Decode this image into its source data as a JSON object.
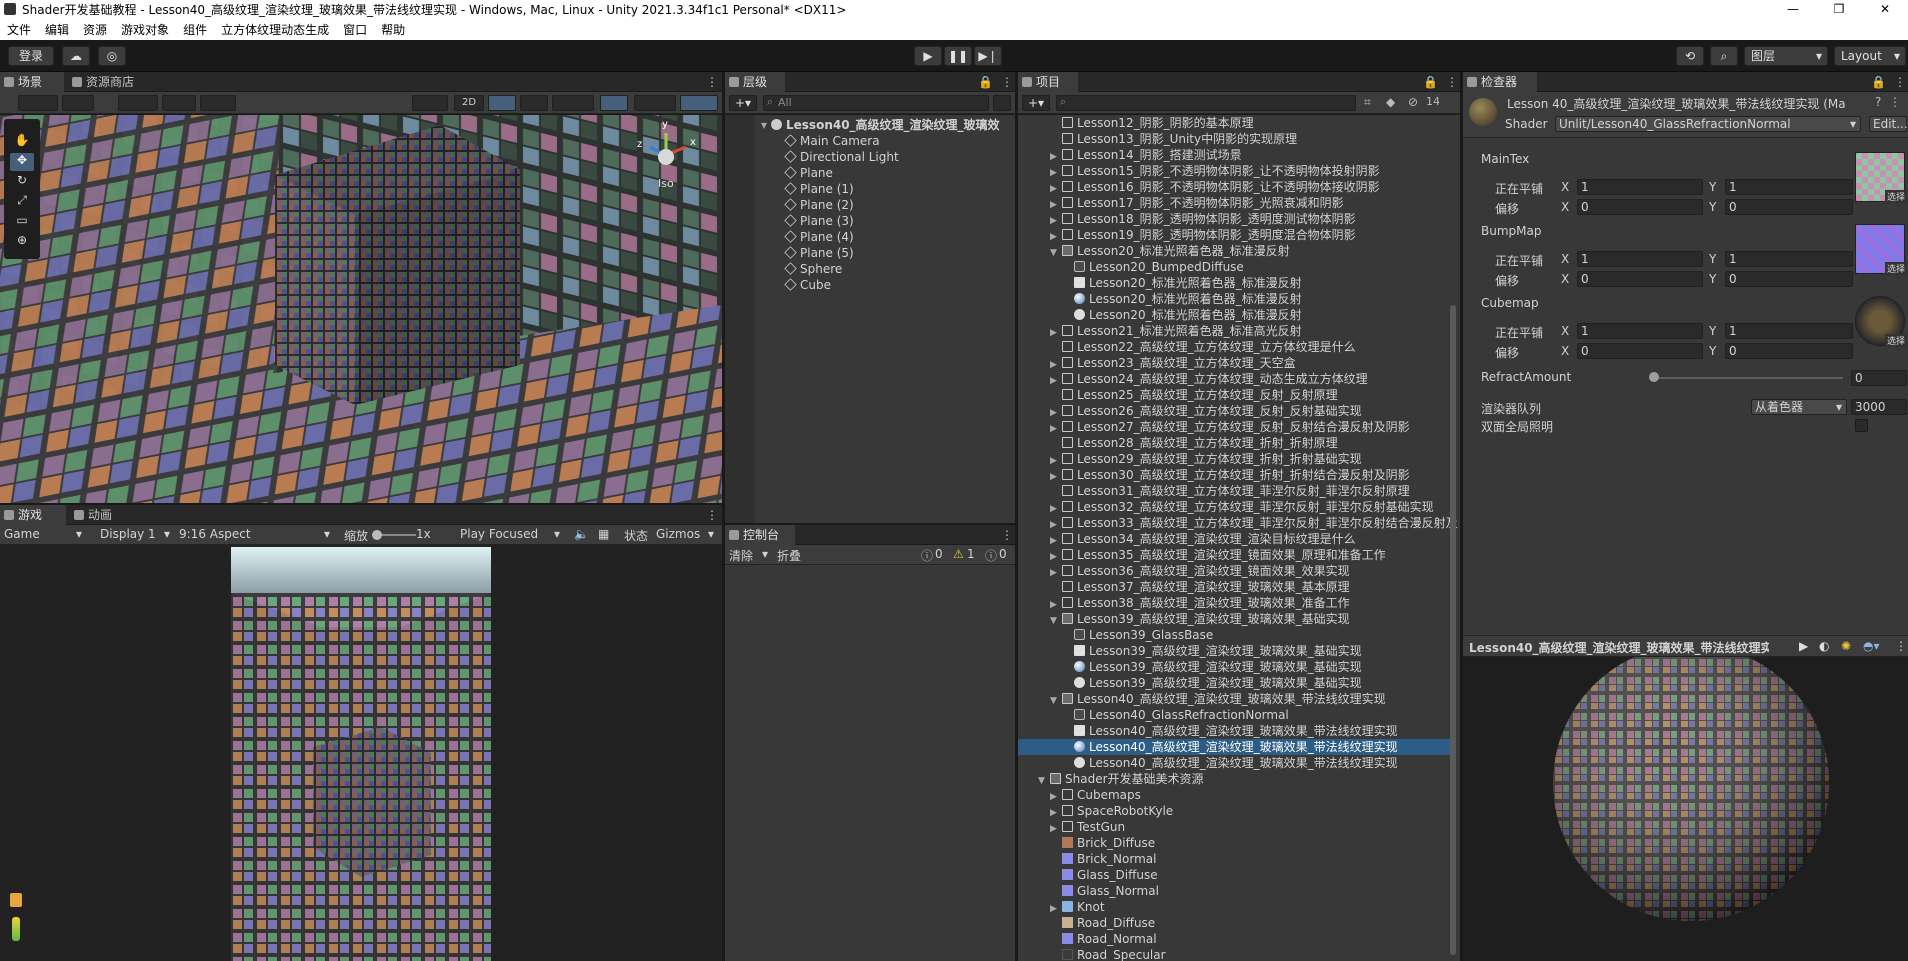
{
  "window": {
    "title": "Shader开发基础教程 - Lesson40_高级纹理_渲染纹理_玻璃效果_带法线纹理实现 - Windows, Mac, Linux - Unity 2021.3.34f1c1 Personal* <DX11>",
    "minimize": "—",
    "maximize": "❐",
    "close": "✕"
  },
  "menu": [
    "文件",
    "编辑",
    "资源",
    "游戏对象",
    "组件",
    "立方体纹理动态生成",
    "窗口",
    "帮助"
  ],
  "toolbar": {
    "login": "登录",
    "layers": "图层",
    "layout": "Layout"
  },
  "scene": {
    "tab_scene": "场景",
    "tab_store": "资源商店",
    "mode_2d": "2D",
    "gizmo_iso": "Iso",
    "gizmo_y": "y",
    "gizmo_z": "z",
    "gizmo_x": "x"
  },
  "game": {
    "tab_game": "游戏",
    "tab_anim": "动画",
    "display_mode": "Game",
    "display": "Display 1",
    "aspect": "9:16 Aspect",
    "scale_label": "缩放",
    "scale_value": "1x",
    "play_focused": "Play Focused",
    "stats": "状态",
    "gizmos": "Gizmos"
  },
  "hierarchy": {
    "tab": "层级",
    "search_placeholder": "All",
    "root": "Lesson40_高级纹理_渲染纹理_玻璃效",
    "items": [
      "Main Camera",
      "Directional Light",
      "Plane",
      "Plane (1)",
      "Plane (2)",
      "Plane (3)",
      "Plane (4)",
      "Plane (5)",
      "Sphere",
      "Cube"
    ]
  },
  "console": {
    "tab": "控制台",
    "clear": "清除",
    "collapse": "折叠",
    "count_info": "0",
    "count_warn": "1",
    "count_error": "0"
  },
  "project": {
    "tab": "项目",
    "hidden_count": "14",
    "rows": [
      {
        "text": "Lesson12_阴影_阴影的基本原理",
        "indent": 2,
        "icon": "folder",
        "arrow": "none"
      },
      {
        "text": "Lesson13_阴影_Unity中阴影的实现原理",
        "indent": 2,
        "icon": "folder",
        "arrow": "none"
      },
      {
        "text": "Lesson14_阴影_搭建测试场景",
        "indent": 2,
        "icon": "folder",
        "arrow": "closed"
      },
      {
        "text": "Lesson15_阴影_不透明物体阴影_让不透明物体投射阴影",
        "indent": 2,
        "icon": "folder",
        "arrow": "closed"
      },
      {
        "text": "Lesson16_阴影_不透明物体阴影_让不透明物体接收阴影",
        "indent": 2,
        "icon": "folder",
        "arrow": "closed"
      },
      {
        "text": "Lesson17_阴影_不透明物体阴影_光照衰减和阴影",
        "indent": 2,
        "icon": "folder",
        "arrow": "closed"
      },
      {
        "text": "Lesson18_阴影_透明物体阴影_透明度测试物体阴影",
        "indent": 2,
        "icon": "folder",
        "arrow": "closed"
      },
      {
        "text": "Lesson19_阴影_透明物体阴影_透明度混合物体阴影",
        "indent": 2,
        "icon": "folder",
        "arrow": "closed"
      },
      {
        "text": "Lesson20_标准光照着色器_标准漫反射",
        "indent": 2,
        "icon": "folder-open",
        "arrow": "open"
      },
      {
        "text": "Lesson20_BumpedDiffuse",
        "indent": 3,
        "icon": "shader",
        "arrow": "none"
      },
      {
        "text": "Lesson20_标准光照着色器_标准漫反射",
        "indent": 3,
        "icon": "script",
        "arrow": "none"
      },
      {
        "text": "Lesson20_标准光照着色器_标准漫反射",
        "indent": 3,
        "icon": "material",
        "arrow": "none"
      },
      {
        "text": "Lesson20_标准光照着色器_标准漫反射",
        "indent": 3,
        "icon": "unity",
        "arrow": "none"
      },
      {
        "text": "Lesson21_标准光照着色器_标准高光反射",
        "indent": 2,
        "icon": "folder",
        "arrow": "closed"
      },
      {
        "text": "Lesson22_高级纹理_立方体纹理_立方体纹理是什么",
        "indent": 2,
        "icon": "folder",
        "arrow": "none"
      },
      {
        "text": "Lesson23_高级纹理_立方体纹理_天空盒",
        "indent": 2,
        "icon": "folder",
        "arrow": "closed"
      },
      {
        "text": "Lesson24_高级纹理_立方体纹理_动态生成立方体纹理",
        "indent": 2,
        "icon": "folder",
        "arrow": "closed"
      },
      {
        "text": "Lesson25_高级纹理_立方体纹理_反射_反射原理",
        "indent": 2,
        "icon": "folder",
        "arrow": "none"
      },
      {
        "text": "Lesson26_高级纹理_立方体纹理_反射_反射基础实现",
        "indent": 2,
        "icon": "folder",
        "arrow": "closed"
      },
      {
        "text": "Lesson27_高级纹理_立方体纹理_反射_反射结合漫反射及阴影",
        "indent": 2,
        "icon": "folder",
        "arrow": "closed"
      },
      {
        "text": "Lesson28_高级纹理_立方体纹理_折射_折射原理",
        "indent": 2,
        "icon": "folder",
        "arrow": "none"
      },
      {
        "text": "Lesson29_高级纹理_立方体纹理_折射_折射基础实现",
        "indent": 2,
        "icon": "folder",
        "arrow": "closed"
      },
      {
        "text": "Lesson30_高级纹理_立方体纹理_折射_折射结合漫反射及阴影",
        "indent": 2,
        "icon": "folder",
        "arrow": "closed"
      },
      {
        "text": "Lesson31_高级纹理_立方体纹理_菲涅尔反射_菲涅尔反射原理",
        "indent": 2,
        "icon": "folder",
        "arrow": "none"
      },
      {
        "text": "Lesson32_高级纹理_立方体纹理_菲涅尔反射_菲涅尔反射基础实现",
        "indent": 2,
        "icon": "folder",
        "arrow": "closed"
      },
      {
        "text": "Lesson33_高级纹理_立方体纹理_菲涅尔反射_菲涅尔反射结合漫反射及",
        "indent": 2,
        "icon": "folder",
        "arrow": "closed"
      },
      {
        "text": "Lesson34_高级纹理_渲染纹理_渲染目标纹理是什么",
        "indent": 2,
        "icon": "folder",
        "arrow": "closed"
      },
      {
        "text": "Lesson35_高级纹理_渲染纹理_镜面效果_原理和准备工作",
        "indent": 2,
        "icon": "folder",
        "arrow": "closed"
      },
      {
        "text": "Lesson36_高级纹理_渲染纹理_镜面效果_效果实现",
        "indent": 2,
        "icon": "folder",
        "arrow": "closed"
      },
      {
        "text": "Lesson37_高级纹理_渲染纹理_玻璃效果_基本原理",
        "indent": 2,
        "icon": "folder",
        "arrow": "none"
      },
      {
        "text": "Lesson38_高级纹理_渲染纹理_玻璃效果_准备工作",
        "indent": 2,
        "icon": "folder",
        "arrow": "closed"
      },
      {
        "text": "Lesson39_高级纹理_渲染纹理_玻璃效果_基础实现",
        "indent": 2,
        "icon": "folder-open",
        "arrow": "open"
      },
      {
        "text": "Lesson39_GlassBase",
        "indent": 3,
        "icon": "shader",
        "arrow": "none"
      },
      {
        "text": "Lesson39_高级纹理_渲染纹理_玻璃效果_基础实现",
        "indent": 3,
        "icon": "script",
        "arrow": "none"
      },
      {
        "text": "Lesson39_高级纹理_渲染纹理_玻璃效果_基础实现",
        "indent": 3,
        "icon": "material",
        "arrow": "none"
      },
      {
        "text": "Lesson39_高级纹理_渲染纹理_玻璃效果_基础实现",
        "indent": 3,
        "icon": "unity",
        "arrow": "none"
      },
      {
        "text": "Lesson40_高级纹理_渲染纹理_玻璃效果_带法线纹理实现",
        "indent": 2,
        "icon": "folder-open",
        "arrow": "open"
      },
      {
        "text": "Lesson40_GlassRefractionNormal",
        "indent": 3,
        "icon": "shader",
        "arrow": "none"
      },
      {
        "text": "Lesson40_高级纹理_渲染纹理_玻璃效果_带法线纹理实现",
        "indent": 3,
        "icon": "script",
        "arrow": "none"
      },
      {
        "text": "Lesson40_高级纹理_渲染纹理_玻璃效果_带法线纹理实现",
        "indent": 3,
        "icon": "material",
        "arrow": "none",
        "selected": true
      },
      {
        "text": "Lesson40_高级纹理_渲染纹理_玻璃效果_带法线纹理实现",
        "indent": 3,
        "icon": "unity",
        "arrow": "none"
      },
      {
        "text": "Shader开发基础美术资源",
        "indent": 1,
        "icon": "folder-open",
        "arrow": "open"
      },
      {
        "text": "Cubemaps",
        "indent": 2,
        "icon": "folder",
        "arrow": "closed"
      },
      {
        "text": "SpaceRobotKyle",
        "indent": 2,
        "icon": "folder",
        "arrow": "closed"
      },
      {
        "text": "TestGun",
        "indent": 2,
        "icon": "folder",
        "arrow": "closed"
      },
      {
        "text": "Brick_Diffuse",
        "indent": 2,
        "icon": "tex-brown",
        "arrow": "none"
      },
      {
        "text": "Brick_Normal",
        "indent": 2,
        "icon": "tex-blue",
        "arrow": "none"
      },
      {
        "text": "Glass_Diffuse",
        "indent": 2,
        "icon": "tex-blue",
        "arrow": "none"
      },
      {
        "text": "Glass_Normal",
        "indent": 2,
        "icon": "tex-blue",
        "arrow": "none"
      },
      {
        "text": "Knot",
        "indent": 2,
        "icon": "model",
        "arrow": "closed"
      },
      {
        "text": "Road_Diffuse",
        "indent": 2,
        "icon": "tex-tan",
        "arrow": "none"
      },
      {
        "text": "Road_Normal",
        "indent": 2,
        "icon": "tex-blue",
        "arrow": "none"
      },
      {
        "text": "Road_Specular",
        "indent": 2,
        "icon": "tex-dark",
        "arrow": "none"
      }
    ]
  },
  "inspector": {
    "tab": "检查器",
    "title": "Lesson 40_高级纹理_渲染纹理_玻璃效果_带法线纹理实现 (Ma",
    "shader_label": "Shader",
    "shader_value": "Unlit/Lesson40_GlassRefractionNormal",
    "edit": "Edit...",
    "maintex": "MainTex",
    "bumpmap": "BumpMap",
    "cubemap": "Cubemap",
    "tiling": "正在平铺",
    "offset": "偏移",
    "x": "X",
    "y": "Y",
    "tiling_x": "1",
    "tiling_y": "1",
    "offset_x": "0",
    "offset_y": "0",
    "select": "选择",
    "refract_label": "RefractAmount",
    "refract_value": "0",
    "queue_label": "渲染器队列",
    "queue_mode": "从着色器",
    "queue_value": "3000",
    "gi_label": "双面全局照明",
    "preview_title": "Lesson40_高级纹理_渲染纹理_玻璃效果_带法线纹理实"
  },
  "colors": {
    "selection": "#2c5d87",
    "panel": "#383838",
    "background": "#191919"
  }
}
